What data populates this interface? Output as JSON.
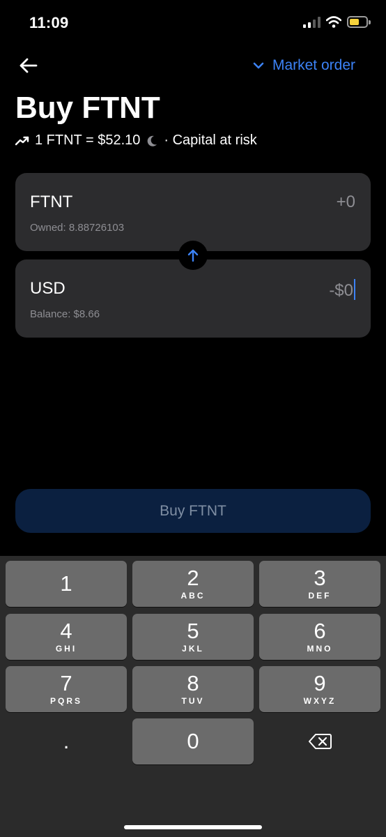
{
  "status_bar": {
    "time": "11:09"
  },
  "header": {
    "order_type_label": "Market order"
  },
  "title": "Buy FTNT",
  "rate": {
    "text": "1 FTNT = $52.10",
    "suffix": "· Capital at risk"
  },
  "ftnt_card": {
    "currency": "FTNT",
    "amount": "+0",
    "owned_label": "Owned: 8.88726103"
  },
  "usd_card": {
    "currency": "USD",
    "amount": "-$0",
    "balance_label": "Balance: $8.66"
  },
  "buy_button_label": "Buy FTNT",
  "keyboard": {
    "keys": [
      {
        "num": "1",
        "letters": ""
      },
      {
        "num": "2",
        "letters": "ABC"
      },
      {
        "num": "3",
        "letters": "DEF"
      },
      {
        "num": "4",
        "letters": "GHI"
      },
      {
        "num": "5",
        "letters": "JKL"
      },
      {
        "num": "6",
        "letters": "MNO"
      },
      {
        "num": "7",
        "letters": "PQRS"
      },
      {
        "num": "8",
        "letters": "TUV"
      },
      {
        "num": "9",
        "letters": "WXYZ"
      }
    ],
    "decimal": ".",
    "zero": "0"
  },
  "colors": {
    "accent": "#3c82f6",
    "card": "#2c2c2e",
    "buy_button": "#0b2040",
    "key": "#6b6b6b",
    "keyboard_bg": "#2b2b2b",
    "battery": "#f7d33c"
  }
}
